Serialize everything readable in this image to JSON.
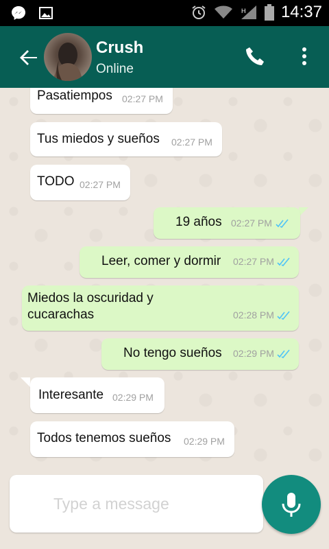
{
  "status_bar": {
    "time": "14:37",
    "icons": [
      "messenger-icon",
      "image-icon",
      "alarm-icon",
      "wifi-icon",
      "signal-icon",
      "battery-icon"
    ]
  },
  "header": {
    "contact_name": "Crush",
    "contact_status": "Online",
    "icons": [
      "back-arrow-icon",
      "avatar",
      "phone-icon",
      "more-vert-icon"
    ],
    "color": "#075e54"
  },
  "messages": [
    {
      "direction": "in",
      "text": "Pasatiempos",
      "time": "02:27 PM"
    },
    {
      "direction": "in",
      "text": "Tus miedos y sueños",
      "time": "02:27 PM"
    },
    {
      "direction": "in",
      "text": "TODO",
      "time": "02:27 PM"
    },
    {
      "direction": "out",
      "text": "19 años",
      "time": "02:27 PM",
      "read": true
    },
    {
      "direction": "out",
      "text": "Leer, comer y dormir",
      "time": "02:27 PM",
      "read": true
    },
    {
      "direction": "out",
      "text": "Miedos la oscuridad y",
      "text2": "cucarachas",
      "time": "02:28 PM",
      "read": true
    },
    {
      "direction": "out",
      "text": "No tengo sueños",
      "time": "02:29 PM",
      "read": true
    },
    {
      "direction": "in",
      "text": "Interesante",
      "time": "02:29 PM"
    },
    {
      "direction": "in",
      "text": "Todos tenemos sueños",
      "time": "02:29 PM"
    }
  ],
  "composer": {
    "placeholder": "Type a message",
    "mic_color": "#128c7e"
  },
  "colors": {
    "incoming_bubble": "#ffffff",
    "outgoing_bubble": "#dcf8c6",
    "read_ticks": "#4fc3f7",
    "chat_background": "#ece5dd"
  }
}
